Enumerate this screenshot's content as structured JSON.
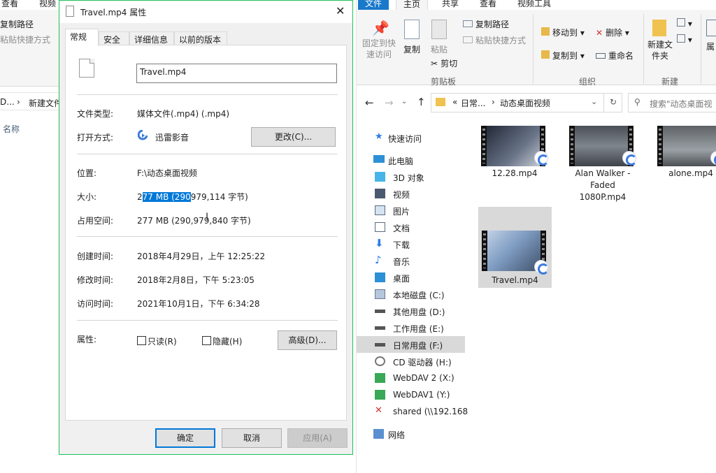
{
  "left_bg": {
    "tab1": "查看",
    "tab2": "视频",
    "copy_path": "复制路径",
    "paste_shortcut": "粘贴快捷方式",
    "addr_prefix": "D...",
    "addr_crumb": "新建文件",
    "col_name": "名称"
  },
  "dialog": {
    "title": "Travel.mp4 属性",
    "tabs": [
      "常规",
      "安全",
      "详细信息",
      "以前的版本"
    ],
    "filename": "Travel.mp4",
    "type_label": "文件类型:",
    "type_value": "媒体文件(.mp4) (.mp4)",
    "open_label": "打开方式:",
    "open_value": "迅雷影音",
    "change_button": "更改(C)...",
    "location_label": "位置:",
    "location_value": "F:\\动态桌面视频",
    "size_label": "大小:",
    "size_pre": "2",
    "size_sel": "77 MB (290",
    "size_post": "979,114 字节)",
    "disk_label": "占用空间:",
    "disk_value": "277 MB (290,979,840 字节)",
    "created_label": "创建时间:",
    "created_value": "2018年4月29日，上午 12:25:22",
    "modified_label": "修改时间:",
    "modified_value": "2018年2月8日，下午 5:23:05",
    "accessed_label": "访问时间:",
    "accessed_value": "2021年10月1日，下午 6:34:28",
    "attr_label": "属性:",
    "readonly_label": "只读(R)",
    "hidden_label": "隐藏(H)",
    "advanced_button": "高级(D)...",
    "ok_button": "确定",
    "cancel_button": "取消",
    "apply_button": "应用(A)"
  },
  "explorer": {
    "tabs": {
      "file": "文件",
      "home": "主页",
      "share": "共享",
      "view": "查看",
      "video_tools": "视频工具"
    },
    "ribbon": {
      "pin_quick": "固定到快速访问",
      "copy": "复制",
      "paste": "粘贴",
      "copy_path": "复制路径",
      "paste_shortcut": "粘贴快捷方式",
      "cut": "剪切",
      "move_to": "移动到",
      "copy_to": "复制到",
      "delete": "删除",
      "rename": "重命名",
      "new_folder": "新建文件夹",
      "group_clipboard": "剪贴板",
      "group_organize": "组织",
      "group_new": "新建",
      "props_short": "属"
    },
    "address": {
      "prefix": "«",
      "crumb1": "日常...",
      "crumb2": "动态桌面视频",
      "search_placeholder": "搜索\"动态桌面视"
    },
    "nav": [
      "快速访问",
      "此电脑",
      "3D 对象",
      "视频",
      "图片",
      "文档",
      "下载",
      "音乐",
      "桌面",
      "本地磁盘 (C:)",
      "其他用盘 (D:)",
      "工作用盘 (E:)",
      "日常用盘 (F:)",
      "CD 驱动器 (H:)",
      "WebDAV 2 (X:)",
      "WebDAV1 (Y:)",
      "shared (\\\\192.168",
      "网络"
    ],
    "files": [
      {
        "name": "12.28.mp4"
      },
      {
        "name": "Alan Walker - Faded 1080P.mp4"
      },
      {
        "name": "alone.mp4"
      },
      {
        "name": "Travel.mp4"
      }
    ]
  }
}
